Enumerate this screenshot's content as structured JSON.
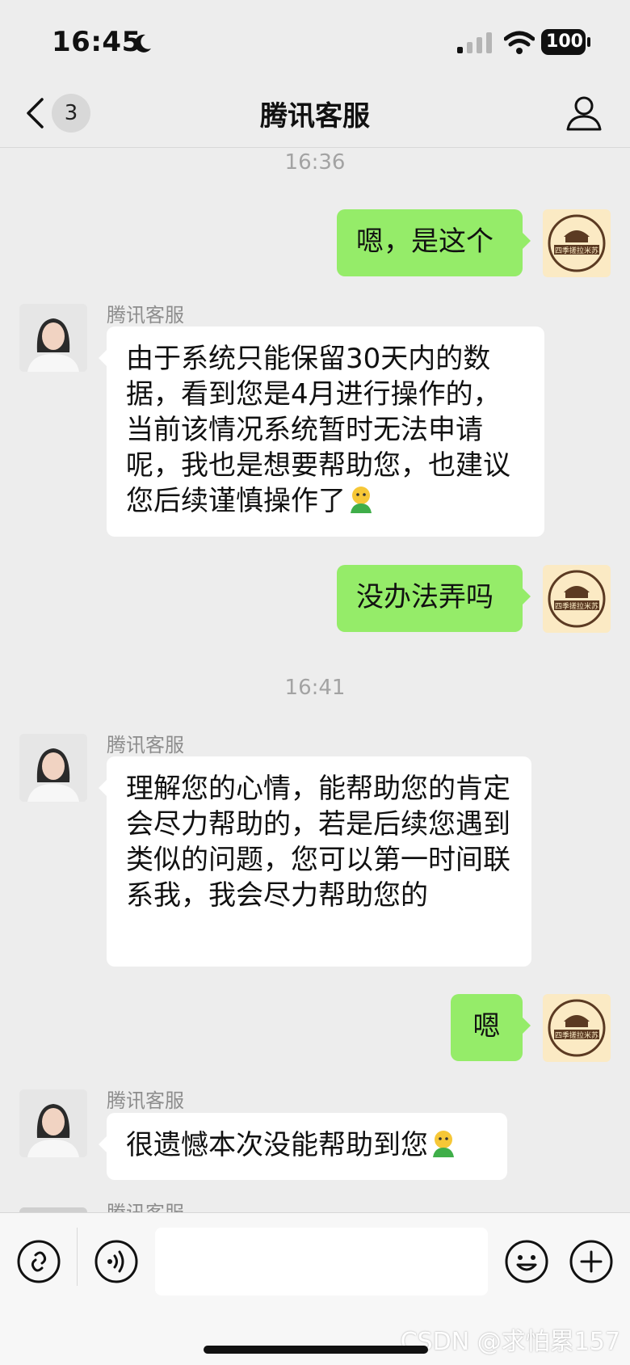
{
  "status_bar": {
    "time": "16:45",
    "battery": "100"
  },
  "nav": {
    "badge": "3",
    "title": "腾讯客服"
  },
  "messages": {
    "time_1": "16:36",
    "user_1": "嗯，是这个",
    "agent_name": "腾讯客服",
    "agent_1": "由于系统只能保留30天内的数据，看到您是4月进行操作的，当前该情况系统暂时无法申请呢，我也是想要帮助您，也建议您后续谨慎操作了",
    "user_2": "没办法弄吗",
    "time_2": "16:41",
    "agent_2": "理解您的心情，能帮助您的肯定会尽力帮助的，若是后续您遇到类似的问题，您可以第一时间联系我，我会尽力帮助您的",
    "user_3": "嗯",
    "agent_3": "很遗憾本次没能帮助到您"
  },
  "user_avatar_text": "四季搓拉米苏",
  "watermark": "CSDN @求怕累157",
  "colors": {
    "user_bubble": "#95ec69",
    "agent_bubble": "#ffffff",
    "background": "#ededed"
  }
}
